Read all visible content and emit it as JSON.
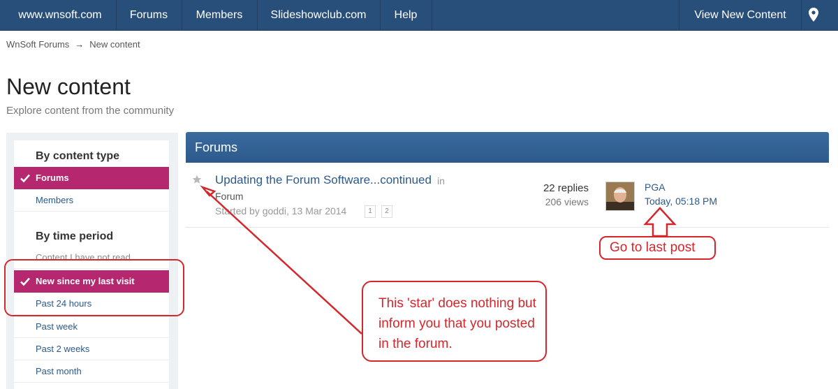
{
  "nav": {
    "items": [
      "www.wnsoft.com",
      "Forums",
      "Members",
      "Slideshowclub.com",
      "Help"
    ],
    "view_new": "View New Content",
    "pin_icon": "map-pin-icon"
  },
  "breadcrumb": {
    "home": "WnSoft Forums",
    "sep": "→",
    "current": "New content"
  },
  "page": {
    "title": "New content",
    "subtitle": "Explore content from the community"
  },
  "sidebar": {
    "content_type_heading": "By content type",
    "content_types": [
      {
        "label": "Forums",
        "active": true
      },
      {
        "label": "Members",
        "active": false
      }
    ],
    "time_period_heading": "By time period",
    "time_periods": [
      {
        "label": "Content I have not read",
        "active": false
      },
      {
        "label": "New since my last visit",
        "active": true
      },
      {
        "label": "Past 24 hours",
        "active": false
      },
      {
        "label": "Past week",
        "active": false
      },
      {
        "label": "Past 2 weeks",
        "active": false
      },
      {
        "label": "Past month",
        "active": false
      }
    ]
  },
  "forums": {
    "header": "Forums",
    "topic": {
      "title": "Updating the Forum Software...continued",
      "in": "in",
      "forum": "Forum",
      "meta": "Started by goddi, 13 Mar 2014",
      "pages": [
        "1",
        "2"
      ],
      "replies": "22 replies",
      "views": "206 views",
      "last_user": "PGA",
      "last_date": "Today, 05:18 PM"
    }
  },
  "annotations": {
    "star_note": "This 'star' does nothing but inform you that you posted in the forum.",
    "last_post_note": "Go to last post",
    "color": "#d5262c"
  },
  "colors": {
    "nav": "#284e7a",
    "active": "#b5276e",
    "link": "#2b5a8a"
  }
}
